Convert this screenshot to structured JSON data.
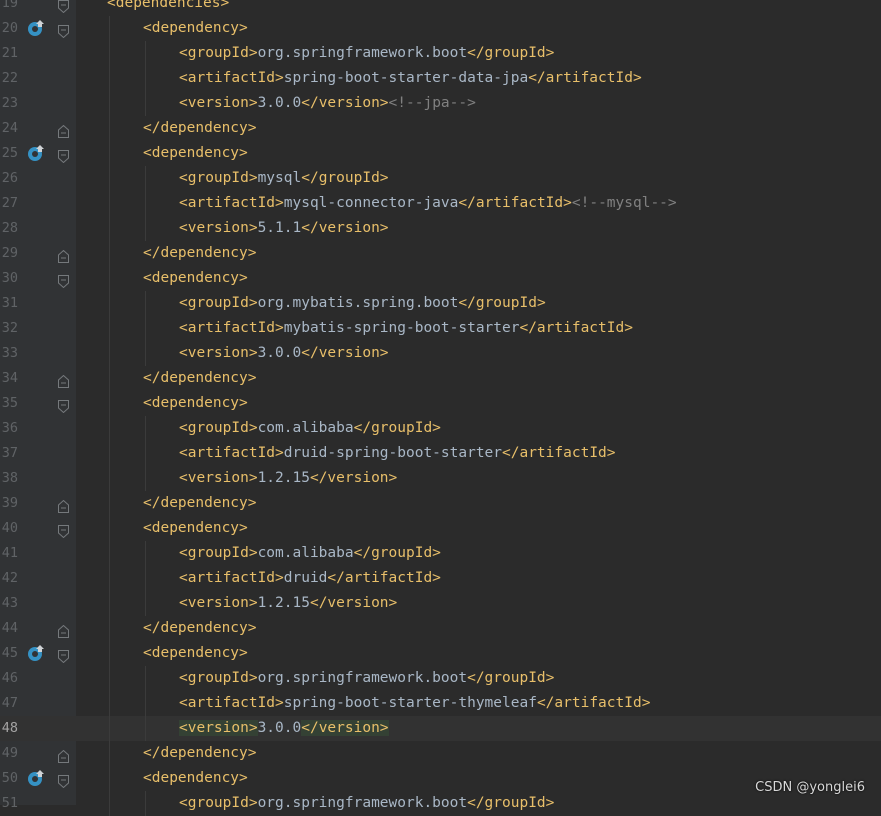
{
  "lines": [
    {
      "num": "19",
      "indent": 1,
      "segments": [
        {
          "t": "tag",
          "v": "<dependencies>"
        }
      ],
      "fold": "open"
    },
    {
      "num": "20",
      "indent": 2,
      "segments": [
        {
          "t": "tag",
          "v": "<dependency>"
        }
      ],
      "fold": "open",
      "icon": "maven-dependency-icon"
    },
    {
      "num": "21",
      "indent": 3,
      "segments": [
        {
          "t": "tag",
          "v": "<groupId>"
        },
        {
          "t": "txt",
          "v": "org.springframework.boot"
        },
        {
          "t": "tag",
          "v": "</groupId>"
        }
      ]
    },
    {
      "num": "22",
      "indent": 3,
      "segments": [
        {
          "t": "tag",
          "v": "<artifactId>"
        },
        {
          "t": "txt",
          "v": "spring-boot-starter-data-jpa"
        },
        {
          "t": "tag",
          "v": "</artifactId>"
        }
      ]
    },
    {
      "num": "23",
      "indent": 3,
      "segments": [
        {
          "t": "tag",
          "v": "<version>"
        },
        {
          "t": "txt",
          "v": "3.0.0"
        },
        {
          "t": "tag",
          "v": "</version>"
        },
        {
          "t": "cmt",
          "v": "<!--jpa-->"
        }
      ]
    },
    {
      "num": "24",
      "indent": 2,
      "segments": [
        {
          "t": "tag",
          "v": "</dependency>"
        }
      ],
      "fold": "close"
    },
    {
      "num": "25",
      "indent": 2,
      "segments": [
        {
          "t": "tag",
          "v": "<dependency>"
        }
      ],
      "fold": "open",
      "icon": "maven-dependency-icon"
    },
    {
      "num": "26",
      "indent": 3,
      "segments": [
        {
          "t": "tag",
          "v": "<groupId>"
        },
        {
          "t": "txt",
          "v": "mysql"
        },
        {
          "t": "tag",
          "v": "</groupId>"
        }
      ]
    },
    {
      "num": "27",
      "indent": 3,
      "segments": [
        {
          "t": "tag",
          "v": "<artifactId>"
        },
        {
          "t": "txt",
          "v": "mysql-connector-java"
        },
        {
          "t": "tag",
          "v": "</artifactId>"
        },
        {
          "t": "cmt",
          "v": "<!--mysql-->"
        }
      ]
    },
    {
      "num": "28",
      "indent": 3,
      "segments": [
        {
          "t": "tag",
          "v": "<version>"
        },
        {
          "t": "txt",
          "v": "5.1.1"
        },
        {
          "t": "tag",
          "v": "</version>"
        }
      ]
    },
    {
      "num": "29",
      "indent": 2,
      "segments": [
        {
          "t": "tag",
          "v": "</dependency>"
        }
      ],
      "fold": "close"
    },
    {
      "num": "30",
      "indent": 2,
      "segments": [
        {
          "t": "tag",
          "v": "<dependency>"
        }
      ],
      "fold": "open"
    },
    {
      "num": "31",
      "indent": 3,
      "segments": [
        {
          "t": "tag",
          "v": "<groupId>"
        },
        {
          "t": "txt",
          "v": "org.mybatis.spring.boot"
        },
        {
          "t": "tag",
          "v": "</groupId>"
        }
      ]
    },
    {
      "num": "32",
      "indent": 3,
      "segments": [
        {
          "t": "tag",
          "v": "<artifactId>"
        },
        {
          "t": "txt",
          "v": "mybatis-spring-boot-starter"
        },
        {
          "t": "tag",
          "v": "</artifactId>"
        }
      ]
    },
    {
      "num": "33",
      "indent": 3,
      "segments": [
        {
          "t": "tag",
          "v": "<version>"
        },
        {
          "t": "txt",
          "v": "3.0.0"
        },
        {
          "t": "tag",
          "v": "</version>"
        }
      ]
    },
    {
      "num": "34",
      "indent": 2,
      "segments": [
        {
          "t": "tag",
          "v": "</dependency>"
        }
      ],
      "fold": "close"
    },
    {
      "num": "35",
      "indent": 2,
      "segments": [
        {
          "t": "tag",
          "v": "<dependency>"
        }
      ],
      "fold": "open"
    },
    {
      "num": "36",
      "indent": 3,
      "segments": [
        {
          "t": "tag",
          "v": "<groupId>"
        },
        {
          "t": "txt",
          "v": "com.alibaba"
        },
        {
          "t": "tag",
          "v": "</groupId>"
        }
      ]
    },
    {
      "num": "37",
      "indent": 3,
      "segments": [
        {
          "t": "tag",
          "v": "<artifactId>"
        },
        {
          "t": "txt",
          "v": "druid-spring-boot-starter"
        },
        {
          "t": "tag",
          "v": "</artifactId>"
        }
      ]
    },
    {
      "num": "38",
      "indent": 3,
      "segments": [
        {
          "t": "tag",
          "v": "<version>"
        },
        {
          "t": "txt",
          "v": "1.2.15"
        },
        {
          "t": "tag",
          "v": "</version>"
        }
      ]
    },
    {
      "num": "39",
      "indent": 2,
      "segments": [
        {
          "t": "tag",
          "v": "</dependency>"
        }
      ],
      "fold": "close"
    },
    {
      "num": "40",
      "indent": 2,
      "segments": [
        {
          "t": "tag",
          "v": "<dependency>"
        }
      ],
      "fold": "open"
    },
    {
      "num": "41",
      "indent": 3,
      "segments": [
        {
          "t": "tag",
          "v": "<groupId>"
        },
        {
          "t": "txt",
          "v": "com.alibaba"
        },
        {
          "t": "tag",
          "v": "</groupId>"
        }
      ]
    },
    {
      "num": "42",
      "indent": 3,
      "segments": [
        {
          "t": "tag",
          "v": "<artifactId>"
        },
        {
          "t": "txt",
          "v": "druid"
        },
        {
          "t": "tag",
          "v": "</artifactId>"
        }
      ]
    },
    {
      "num": "43",
      "indent": 3,
      "segments": [
        {
          "t": "tag",
          "v": "<version>"
        },
        {
          "t": "txt",
          "v": "1.2.15"
        },
        {
          "t": "tag",
          "v": "</version>"
        }
      ]
    },
    {
      "num": "44",
      "indent": 2,
      "segments": [
        {
          "t": "tag",
          "v": "</dependency>"
        }
      ],
      "fold": "close"
    },
    {
      "num": "45",
      "indent": 2,
      "segments": [
        {
          "t": "tag",
          "v": "<dependency>"
        }
      ],
      "fold": "open",
      "icon": "maven-dependency-icon"
    },
    {
      "num": "46",
      "indent": 3,
      "segments": [
        {
          "t": "tag",
          "v": "<groupId>"
        },
        {
          "t": "txt",
          "v": "org.springframework.boot"
        },
        {
          "t": "tag",
          "v": "</groupId>"
        }
      ]
    },
    {
      "num": "47",
      "indent": 3,
      "segments": [
        {
          "t": "tag",
          "v": "<artifactId>"
        },
        {
          "t": "txt",
          "v": "spring-boot-starter-thymeleaf"
        },
        {
          "t": "tag",
          "v": "</artifactId>"
        }
      ]
    },
    {
      "num": "48",
      "indent": 3,
      "current": true,
      "segments": [
        {
          "t": "tag",
          "v": "<version>",
          "hl": true
        },
        {
          "t": "txt",
          "v": "3.0.0"
        },
        {
          "t": "tag",
          "v": "</version>",
          "hl": true
        }
      ]
    },
    {
      "num": "49",
      "indent": 2,
      "segments": [
        {
          "t": "tag",
          "v": "</dependency>"
        }
      ],
      "fold": "close"
    },
    {
      "num": "50",
      "indent": 2,
      "segments": [
        {
          "t": "tag",
          "v": "<dependency>"
        }
      ],
      "fold": "open",
      "icon": "maven-dependency-icon"
    },
    {
      "num": "51",
      "indent": 3,
      "segments": [
        {
          "t": "tag",
          "v": "<groupId>"
        },
        {
          "t": "txt",
          "v": "org.springframework.boot"
        },
        {
          "t": "tag",
          "v": "</groupId>"
        }
      ]
    }
  ],
  "watermark": "CSDN @yonglei6",
  "colors": {
    "tag": "#e8bf6a",
    "text": "#a9b7c6",
    "comment": "#808080",
    "background": "#2b2b2b",
    "gutter": "#313335"
  }
}
